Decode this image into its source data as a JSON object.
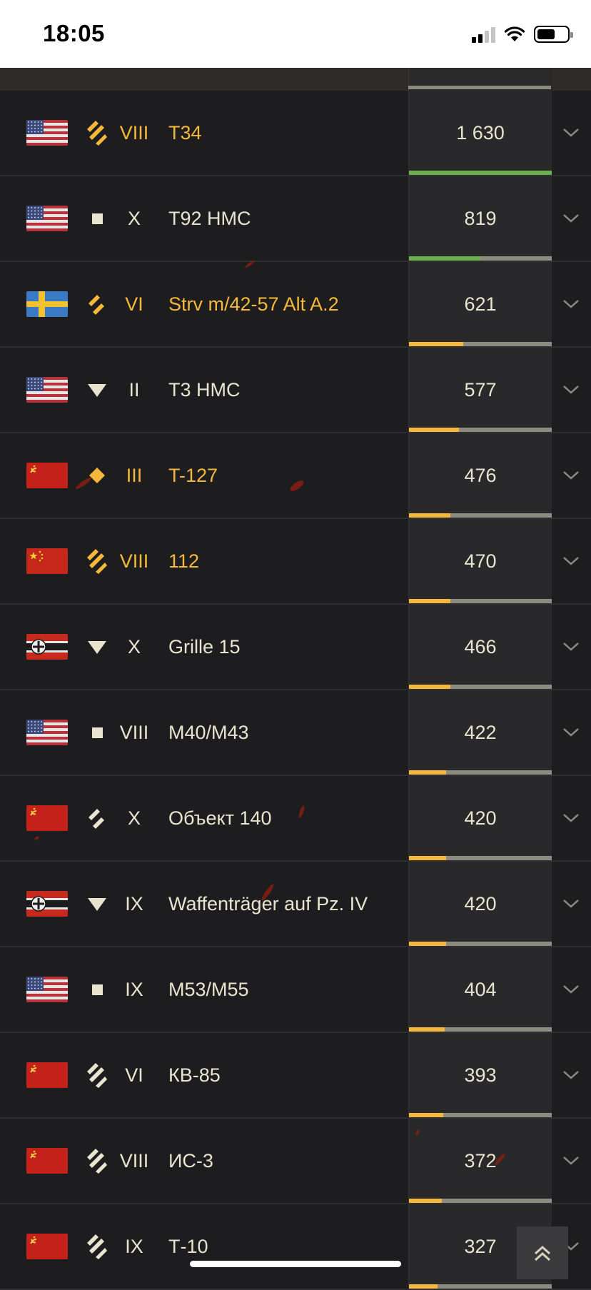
{
  "status_bar": {
    "time": "18:05"
  },
  "colors": {
    "premium_text": "#f5b83b",
    "normal_text": "#e9e4cf",
    "bar_green": "#6ab04c",
    "bar_yellow": "#f5b83b",
    "bar_track": "#8d8b80"
  },
  "vehicles": [
    {
      "flag": "usa",
      "class_icon": "heavy-tank-icon",
      "premium": true,
      "tier": "VIII",
      "name": "T34",
      "value": "1 630",
      "progress": 1.0,
      "bar_color": "green"
    },
    {
      "flag": "usa",
      "class_icon": "spg-icon",
      "premium": false,
      "tier": "X",
      "name": "T92 HMC",
      "value": "819",
      "progress": 0.5,
      "bar_color": "green"
    },
    {
      "flag": "sweden",
      "class_icon": "medium-tank-icon",
      "premium": true,
      "tier": "VI",
      "name": "Strv m/42-57 Alt A.2",
      "value": "621",
      "progress": 0.38,
      "bar_color": "yellow"
    },
    {
      "flag": "usa",
      "class_icon": "tank-destroyer-icon",
      "premium": false,
      "tier": "II",
      "name": "T3 HMC",
      "value": "577",
      "progress": 0.35,
      "bar_color": "yellow"
    },
    {
      "flag": "ussr",
      "class_icon": "light-tank-icon",
      "premium": true,
      "tier": "III",
      "name": "T-127",
      "value": "476",
      "progress": 0.29,
      "bar_color": "yellow"
    },
    {
      "flag": "china",
      "class_icon": "heavy-tank-icon",
      "premium": true,
      "tier": "VIII",
      "name": "112",
      "value": "470",
      "progress": 0.29,
      "bar_color": "yellow"
    },
    {
      "flag": "germany",
      "class_icon": "tank-destroyer-icon",
      "premium": false,
      "tier": "X",
      "name": "Grille 15",
      "value": "466",
      "progress": 0.29,
      "bar_color": "yellow"
    },
    {
      "flag": "usa",
      "class_icon": "spg-icon",
      "premium": false,
      "tier": "VIII",
      "name": "M40/M43",
      "value": "422",
      "progress": 0.26,
      "bar_color": "yellow"
    },
    {
      "flag": "ussr",
      "class_icon": "medium-tank-icon",
      "premium": false,
      "tier": "X",
      "name": "Объект 140",
      "value": "420",
      "progress": 0.26,
      "bar_color": "yellow"
    },
    {
      "flag": "germany",
      "class_icon": "tank-destroyer-icon",
      "premium": false,
      "tier": "IX",
      "name": "Waffenträger auf Pz. IV",
      "value": "420",
      "progress": 0.26,
      "bar_color": "yellow"
    },
    {
      "flag": "usa",
      "class_icon": "spg-icon",
      "premium": false,
      "tier": "IX",
      "name": "M53/M55",
      "value": "404",
      "progress": 0.25,
      "bar_color": "yellow"
    },
    {
      "flag": "ussr",
      "class_icon": "heavy-tank-icon",
      "premium": false,
      "tier": "VI",
      "name": "КВ-85",
      "value": "393",
      "progress": 0.24,
      "bar_color": "yellow"
    },
    {
      "flag": "ussr",
      "class_icon": "heavy-tank-icon",
      "premium": false,
      "tier": "VIII",
      "name": "ИС-3",
      "value": "372",
      "progress": 0.23,
      "bar_color": "yellow"
    },
    {
      "flag": "ussr",
      "class_icon": "heavy-tank-icon",
      "premium": false,
      "tier": "IX",
      "name": "Т-10",
      "value": "327",
      "progress": 0.2,
      "bar_color": "yellow"
    }
  ]
}
